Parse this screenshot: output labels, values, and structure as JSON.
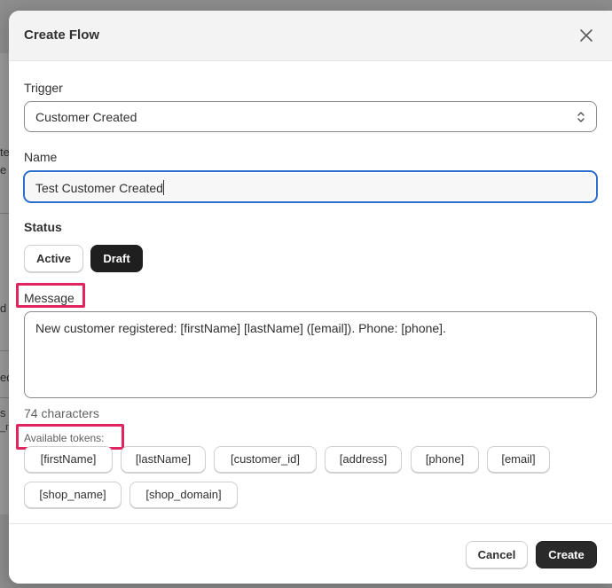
{
  "modal": {
    "title": "Create Flow"
  },
  "trigger": {
    "label": "Trigger",
    "selected": "Customer Created"
  },
  "name": {
    "label": "Name",
    "value": "Test Customer Created"
  },
  "status": {
    "label": "Status",
    "options": [
      "Active",
      "Draft"
    ],
    "selected": "Draft"
  },
  "message": {
    "label": "Message",
    "value": "New customer registered: [firstName] [lastName] ([email]). Phone: [phone].",
    "char_count": "74 characters"
  },
  "tokens": {
    "label": "Available tokens:",
    "items": [
      "[firstName]",
      "[lastName]",
      "[customer_id]",
      "[address]",
      "[phone]",
      "[email]",
      "[shop_name]",
      "[shop_domain]"
    ]
  },
  "footer": {
    "cancel_label": "Cancel",
    "create_label": "Create"
  },
  "background": {
    "fragments": [
      "te",
      "e",
      "d",
      "ed",
      "s",
      "_re"
    ]
  },
  "colors": {
    "highlight": "#e0245e",
    "focus_ring": "#2c6ecb",
    "primary_button": "#2a2a2a"
  }
}
